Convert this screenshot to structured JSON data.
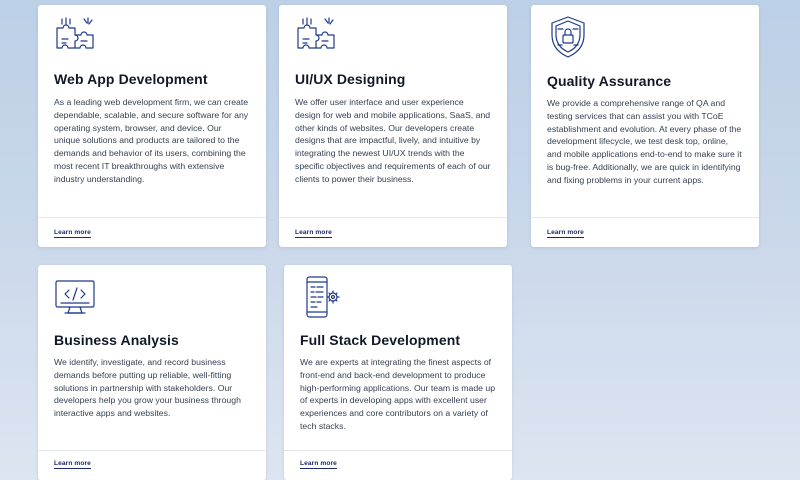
{
  "cards": [
    {
      "icon": "puzzle-icon",
      "title": "Web App Development",
      "description": "As a leading web development firm, we can create dependable, scalable, and secure software for any operating system, browser, and device. Our unique solutions and products are tailored to the demands and behavior of its users, combining the most recent IT breakthroughs with extensive industry understanding.",
      "link": "Learn more"
    },
    {
      "icon": "puzzle-icon",
      "title": "UI/UX Designing",
      "description": "We offer user interface and user experience design for web and mobile applications, SaaS, and other kinds of websites. Our developers create designs that are impactful, lively, and intuitive by integrating the newest UI/UX trends with the specific objectives and requirements of each of our clients to power their business.",
      "link": "Learn more"
    },
    {
      "icon": "shield-lock-icon",
      "title": "Quality Assurance",
      "description": "We provide a comprehensive range of QA and testing services that can assist you with TCoE establishment and evolution. At every phase of the development lifecycle, we test desk top, online, and mobile applications end-to-end to make sure it is bug-free. Additionally, we are quick in identifying and fixing problems in your current apps.",
      "link": "Learn more"
    },
    {
      "icon": "monitor-code-icon",
      "title": "Business Analysis",
      "description": "We identify, investigate, and record business demands before putting up reliable, well-fitting solutions in partnership with stakeholders. Our developers help you grow your business through interactive apps and websites.",
      "link": "Learn more"
    },
    {
      "icon": "mobile-gear-icon",
      "title": "Full Stack Development",
      "description": "We are experts at integrating the finest aspects of front-end and back-end development to produce high-performing applications. Our team is made up of experts in developing apps with excellent user experiences and core contributors on a variety of tech stacks.",
      "link": "Learn more"
    }
  ],
  "colors": {
    "icon": "#1e3a8a",
    "title": "#111827",
    "text": "#374151",
    "link": "#1f2a6b"
  }
}
